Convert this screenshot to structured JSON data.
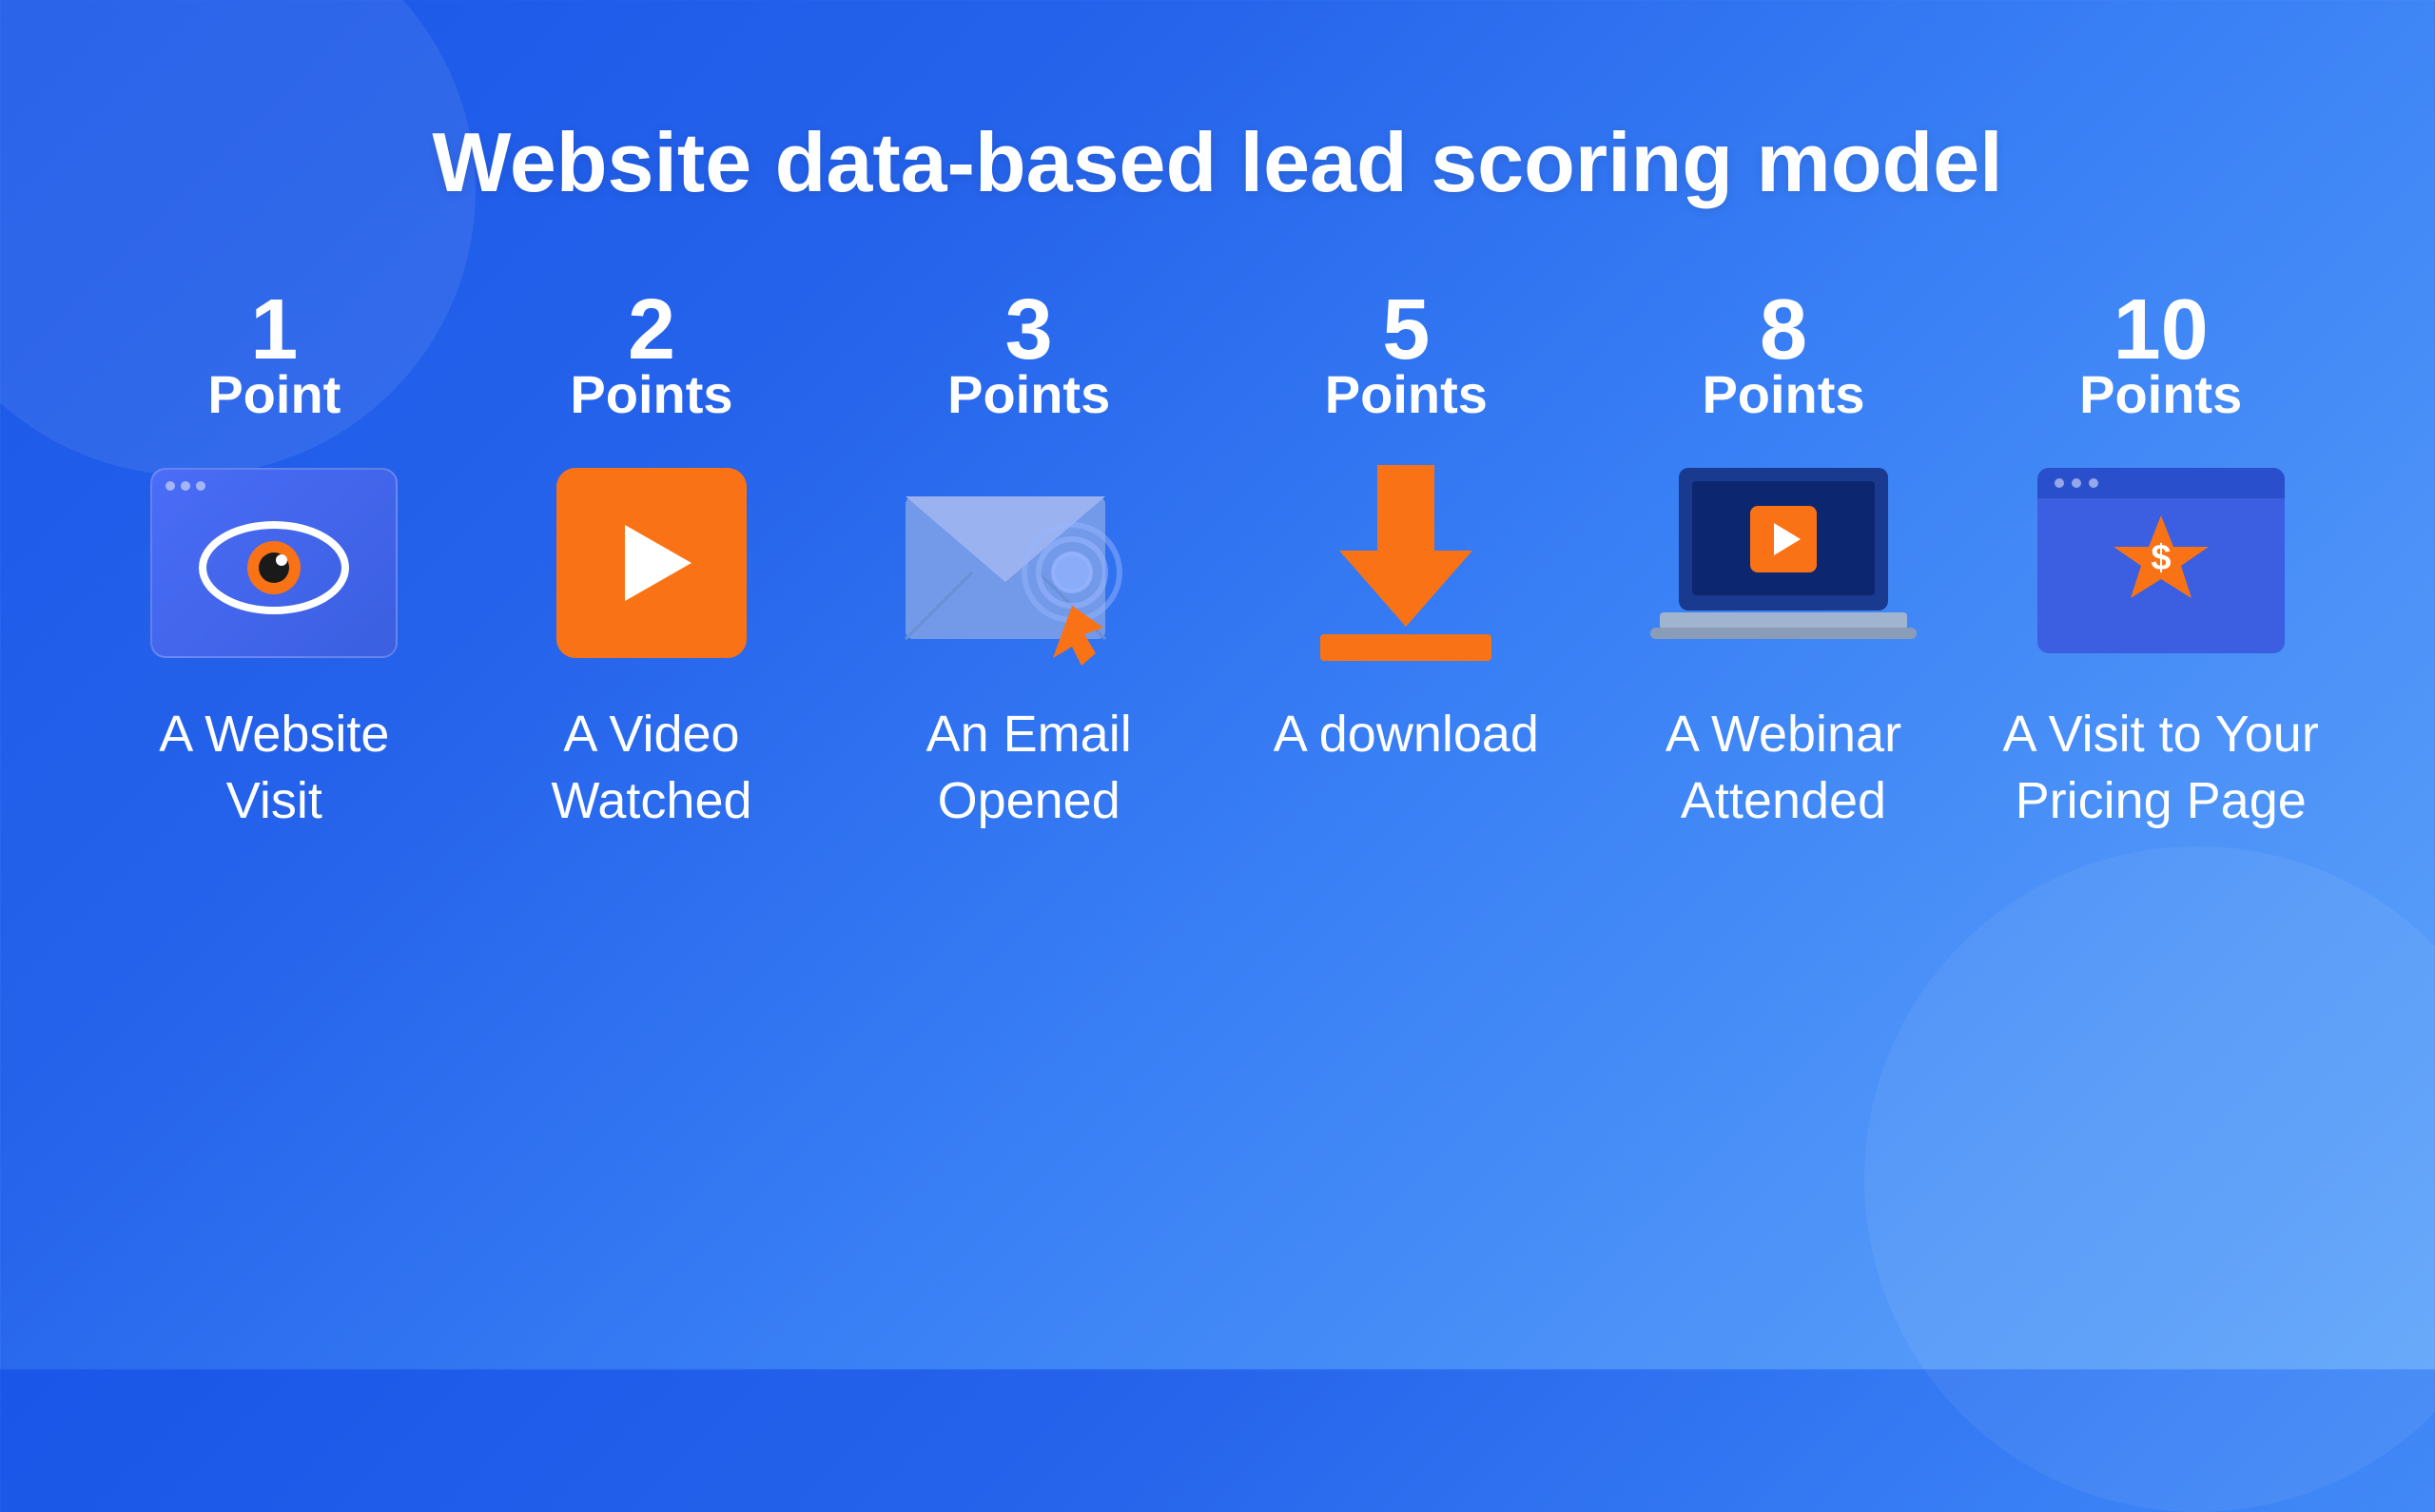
{
  "page": {
    "title": "Website data-based lead scoring model",
    "background_gradient_start": "#1a56e8",
    "background_gradient_end": "#60a5fa"
  },
  "items": [
    {
      "id": "website-visit",
      "points_value": "1",
      "points_label": "Point",
      "label": "A Website Visit",
      "icon_type": "browser-eye"
    },
    {
      "id": "video-watched",
      "points_value": "2",
      "points_label": "Points",
      "label": "A Video Watched",
      "icon_type": "play-button"
    },
    {
      "id": "email-opened",
      "points_value": "3",
      "points_label": "Points",
      "label": "An Email Opened",
      "icon_type": "email"
    },
    {
      "id": "download",
      "points_value": "5",
      "points_label": "Points",
      "label": "A download",
      "icon_type": "download-arrow"
    },
    {
      "id": "webinar-attended",
      "points_value": "8",
      "points_label": "Points",
      "label": "A Webinar Attended",
      "icon_type": "laptop"
    },
    {
      "id": "pricing-page",
      "points_value": "10",
      "points_label": "Points",
      "label": "A Visit to Your Pricing Page",
      "icon_type": "pricing-browser"
    }
  ]
}
